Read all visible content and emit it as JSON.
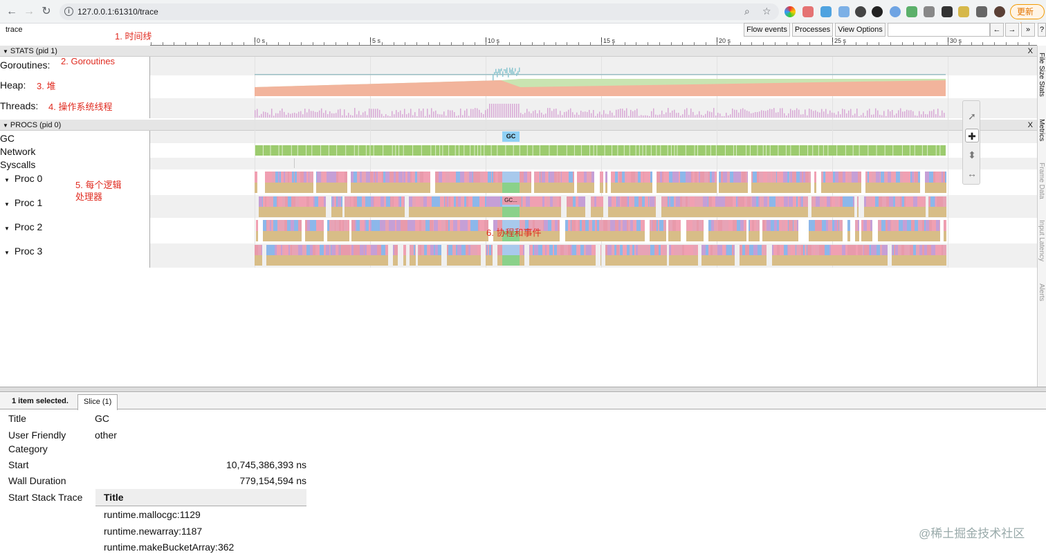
{
  "browser": {
    "url": "127.0.0.1:61310/trace",
    "update_label": "更新"
  },
  "toolbar": {
    "title": "trace",
    "flow_events": "Flow events",
    "processes": "Processes",
    "view_options": "View Options",
    "nav_prev": "←",
    "nav_next": "→",
    "more": "»",
    "help": "?"
  },
  "ruler": {
    "labels": [
      "0 s",
      "5 s",
      "10 s",
      "15 s",
      "20 s",
      "25 s",
      "30 s"
    ]
  },
  "stats": {
    "header": "STATS (pid 1)",
    "close": "X",
    "rows": [
      "Goroutines:",
      "Heap:",
      "Threads:"
    ]
  },
  "procs": {
    "header": "PROCS (pid 0)",
    "close": "X",
    "rows": [
      "GC",
      "Network",
      "Syscalls"
    ],
    "proc_rows": [
      "Proc 0",
      "Proc 1",
      "Proc 2",
      "Proc 3"
    ],
    "gc_slice": "GC",
    "gc_short": "GC..."
  },
  "annotations": {
    "a1": "1. 时间线",
    "a2": "2. Goroutines",
    "a3": "3. 堆",
    "a4": "4. 操作系统线程",
    "a5_line1": "5. 每个逻辑",
    "a5_line2": "处理器",
    "a6": "6. 协程和事件"
  },
  "side_tabs": [
    "File Size Stats",
    "Metrics",
    "Frame Data",
    "Input Latency",
    "Alerts"
  ],
  "selection": {
    "count": "1 item selected.",
    "tab": "Slice (1)",
    "fields": {
      "title_key": "Title",
      "title_val": "GC",
      "cat_key_1": "User Friendly",
      "cat_key_2": "Category",
      "cat_val": "other",
      "start_key": "Start",
      "start_val": "10,745,386,393 ns",
      "dur_key": "Wall Duration",
      "dur_val": "779,154,594 ns",
      "stack_key": "Start Stack Trace"
    },
    "stack_header": "Title",
    "stack": [
      "runtime.mallocgc:1129",
      "runtime.newarray:1187",
      "runtime.makeBucketArray:362"
    ]
  },
  "watermark": "@稀土掘金技术社区",
  "colors": {
    "heap_alloc": "#f2b49c",
    "heap_next": "#c9e4b1",
    "threads": "#d9a8d6",
    "network": "#9ccb6e",
    "gc_slice": "#8fd0f5",
    "proc_top_palette": [
      "#e89aab",
      "#8cb7ea",
      "#e7a3b6",
      "#c59fd6",
      "#f0a0b2"
    ],
    "proc_bottom": "#d8bd87",
    "gc_band": "#8ad18a"
  }
}
